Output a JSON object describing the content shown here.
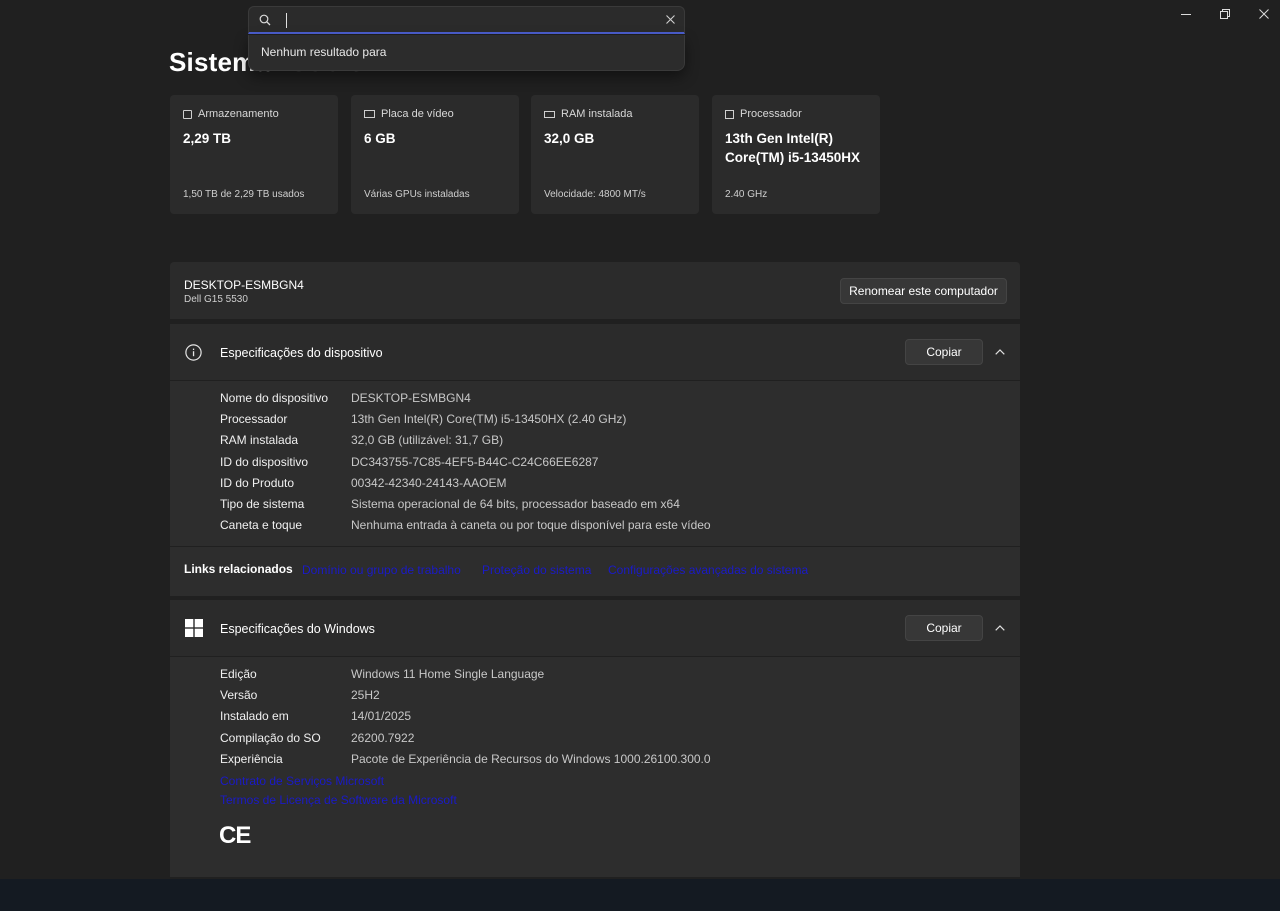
{
  "window": {
    "controls": [
      "minimize-icon",
      "restore-icon",
      "close-icon"
    ]
  },
  "page": {
    "title": "Sistema",
    "title_ghost": "Sobre"
  },
  "search": {
    "value": "",
    "no_results": "Nenhum resultado para"
  },
  "cards": [
    {
      "icon": "storage-icon",
      "label": "Armazenamento",
      "value": "2,29 TB",
      "sub": "1,50 TB de 2,29 TB usados"
    },
    {
      "icon": "gpu-icon",
      "label": "Placa de vídeo",
      "value": "6 GB",
      "sub": "Várias GPUs instaladas"
    },
    {
      "icon": "ram-icon",
      "label": "RAM instalada",
      "value": "32,0 GB",
      "sub": "Velocidade: 4800 MT/s"
    },
    {
      "icon": "cpu-icon",
      "label": "Processador",
      "value": "13th Gen Intel(R) Core(TM) i5-13450HX",
      "sub": "2.40 GHz"
    }
  ],
  "device_header": {
    "name": "DESKTOP-ESMBGN4",
    "model": "Dell G15 5530",
    "rename_button": "Renomear este computador"
  },
  "device_specs": {
    "title": "Especificações do dispositivo",
    "copy_button": "Copiar",
    "rows": [
      {
        "label": "Nome do dispositivo",
        "value": "DESKTOP-ESMBGN4"
      },
      {
        "label": "Processador",
        "value": "13th Gen Intel(R) Core(TM) i5-13450HX (2.40 GHz)"
      },
      {
        "label": "RAM instalada",
        "value": "32,0 GB (utilizável: 31,7 GB)"
      },
      {
        "label": "ID do dispositivo",
        "value": "DC343755-7C85-4EF5-B44C-C24C66EE6287"
      },
      {
        "label": "ID do Produto",
        "value": "00342-42340-24143-AAOEM"
      },
      {
        "label": "Tipo de sistema",
        "value": "Sistema operacional de 64 bits, processador baseado em x64"
      },
      {
        "label": "Caneta e toque",
        "value": "Nenhuma entrada à caneta ou por toque disponível para este vídeo"
      }
    ]
  },
  "related_links": {
    "label": "Links relacionados",
    "links": [
      "Domínio ou grupo de trabalho",
      "Proteção do sistema",
      "Configurações avançadas do sistema"
    ]
  },
  "windows_specs": {
    "title": "Especificações do Windows",
    "copy_button": "Copiar",
    "rows": [
      {
        "label": "Edição",
        "value": "Windows 11 Home Single Language"
      },
      {
        "label": "Versão",
        "value": "25H2"
      },
      {
        "label": "Instalado em",
        "value": "14/01/2025"
      },
      {
        "label": "Compilação do SO",
        "value": "26200.7922"
      },
      {
        "label": "Experiência",
        "value": "Pacote de Experiência de Recursos do Windows 1000.26100.300.0"
      }
    ],
    "links": [
      "Contrato de Serviços Microsoft",
      "Termos de Licença de Software da Microsoft"
    ],
    "ce_mark": "CE"
  },
  "colors": {
    "background": "#202020",
    "card": "#2b2b2b",
    "link": "#1a1ac8",
    "accent": "#4c5fd0"
  }
}
